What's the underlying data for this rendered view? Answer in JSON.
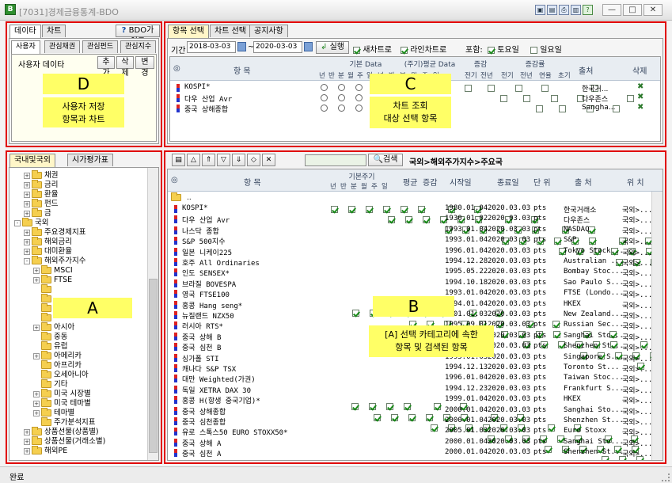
{
  "window": {
    "title": "[7031]경제금융통계-BDO",
    "app_icon": "B"
  },
  "left_top": {
    "tabs": [
      "데이타",
      "차트"
    ],
    "guide_label": "BDO가이드",
    "subtabs": [
      "사용자",
      "관심채권",
      "관심펀드",
      "관심지수"
    ],
    "user_data_label": "사용자 데이타",
    "buttons": [
      "추가",
      "삭제",
      "변경"
    ]
  },
  "callout_d": {
    "letter": "D",
    "line1": "사용자 저장",
    "line2": "항목과 차트"
  },
  "left_bottom": {
    "tabs": [
      "국내및국외",
      "시가평가표"
    ]
  },
  "tree": [
    {
      "label": "채권",
      "indent": 2,
      "exp": "+"
    },
    {
      "label": "금리",
      "indent": 2,
      "exp": "+"
    },
    {
      "label": "환율",
      "indent": 2,
      "exp": "+"
    },
    {
      "label": "펀드",
      "indent": 2,
      "exp": "+"
    },
    {
      "label": "금",
      "indent": 2,
      "exp": "+"
    },
    {
      "label": "국외",
      "indent": 1,
      "exp": "-"
    },
    {
      "label": "주요경제지표",
      "indent": 2,
      "exp": "+"
    },
    {
      "label": "해외금리",
      "indent": 2,
      "exp": "+"
    },
    {
      "label": "대미환율",
      "indent": 2,
      "exp": "+"
    },
    {
      "label": "해외주가지수",
      "indent": 2,
      "exp": "-"
    },
    {
      "label": "MSCI",
      "indent": 3,
      "exp": "+"
    },
    {
      "label": "FTSE",
      "indent": 3,
      "exp": "+"
    },
    {
      "label": "",
      "indent": 3,
      "exp": ""
    },
    {
      "label": "",
      "indent": 3,
      "exp": ""
    },
    {
      "label": "",
      "indent": 3,
      "exp": ""
    },
    {
      "label": "",
      "indent": 3,
      "exp": ""
    },
    {
      "label": "아시아",
      "indent": 3,
      "exp": "+"
    },
    {
      "label": "중동",
      "indent": 3,
      "exp": ""
    },
    {
      "label": "유럽",
      "indent": 3,
      "exp": ""
    },
    {
      "label": "아메리카",
      "indent": 3,
      "exp": "+"
    },
    {
      "label": "아프리카",
      "indent": 3,
      "exp": ""
    },
    {
      "label": "오세아니아",
      "indent": 3,
      "exp": ""
    },
    {
      "label": "기타",
      "indent": 3,
      "exp": ""
    },
    {
      "label": "미국 시장별",
      "indent": 3,
      "exp": "+"
    },
    {
      "label": "미국 테마별",
      "indent": 3,
      "exp": "+"
    },
    {
      "label": "테마별",
      "indent": 3,
      "exp": "+"
    },
    {
      "label": "주가분석지표",
      "indent": 3,
      "exp": ""
    },
    {
      "label": "상품선물(상품별)",
      "indent": 2,
      "exp": "+"
    },
    {
      "label": "상품선물(거래소별)",
      "indent": 2,
      "exp": "+"
    },
    {
      "label": "해외PE",
      "indent": 2,
      "exp": "+"
    }
  ],
  "callout_a": {
    "letter": "A"
  },
  "right_top": {
    "tabs": [
      "항목 선택",
      "차트 선택",
      "공지사항"
    ],
    "period_label": "기간",
    "date_from": "2018-03-03",
    "date_sep": "~",
    "date_to": "2020-03-03",
    "run_label": "실행",
    "new_chart_label": "새차트로",
    "line_chart_label": "라인차트로",
    "include_label": "포함:",
    "sat_label": "토요일",
    "sun_label": "일요일"
  },
  "top_table": {
    "headers": {
      "item": "항   목",
      "basic": "기본 Data",
      "avg": "(주기)평균 Data",
      "change": "증감",
      "ratio": "증감률",
      "source": "출처",
      "delete": "삭제"
    },
    "sub_headers": [
      "년",
      "반",
      "분",
      "월",
      "주",
      "일",
      "년",
      "반",
      "분",
      "월",
      "주",
      "일",
      "전기",
      "전년",
      "전기",
      "전년",
      "연율",
      "초기"
    ],
    "rows": [
      {
        "name": "KOSPI*",
        "source": "한국거..."
      },
      {
        "name": "다우 산업 Avr",
        "source": "다우존스"
      },
      {
        "name": "중국 상해종합",
        "source": "Sangha..."
      }
    ]
  },
  "callout_c": {
    "letter": "C",
    "line1": "차트 조회",
    "line2": "대상 선택 항목"
  },
  "right_bottom": {
    "search_label": "검색",
    "path": "국외>해외주가지수>주요국",
    "headers": {
      "item": "항   목",
      "period": "기본주기",
      "sub": [
        "년",
        "반",
        "분",
        "월",
        "주",
        "일"
      ],
      "avg": "평균",
      "change": "증감",
      "start": "시작일",
      "end": "종료일",
      "unit": "단 위",
      "source": "출   처",
      "location": "위   치"
    },
    "parent": ".."
  },
  "grid_rows": [
    {
      "name": "KOSPI*",
      "start": "1980.01.04",
      "end": "2020.03.03",
      "unit": "pts",
      "source": "한국거래소",
      "loc": "국외>..."
    },
    {
      "name": "다우 산업 Avr",
      "start": "1930.01.02",
      "end": "2020.03.03",
      "unit": "pts",
      "source": "다우존스",
      "loc": "국외>..."
    },
    {
      "name": "나스닥 종합",
      "start": "1993.01.04",
      "end": "2020.03.03",
      "unit": "pts",
      "source": "NASDAQ",
      "loc": "국외>..."
    },
    {
      "name": "S&P 500지수",
      "start": "1993.01.04",
      "end": "2020.03.03",
      "unit": "pts",
      "source": "S&P",
      "loc": "국외>..."
    },
    {
      "name": "일본 니케이225",
      "start": "1996.01.04",
      "end": "2020.03.03",
      "unit": "pts",
      "source": "Tokyo Stock...",
      "loc": "국외>..."
    },
    {
      "name": "호주 All Ordinaries",
      "start": "1994.12.28",
      "end": "2020.03.03",
      "unit": "pts",
      "source": "Australian ...",
      "loc": "국외>..."
    },
    {
      "name": "인도 SENSEX*",
      "start": "1995.05.22",
      "end": "2020.03.03",
      "unit": "pts",
      "source": "Bombay Stoc...",
      "loc": "국외>..."
    },
    {
      "name": "브라질 BOVESPA",
      "start": "1994.10.18",
      "end": "2020.03.03",
      "unit": "pts",
      "source": "Sao Paulo S...",
      "loc": "국외>..."
    },
    {
      "name": "영국 FTSE100",
      "start": "1993.01.04",
      "end": "2020.03.03",
      "unit": "pts",
      "source": "FTSE (Londo...",
      "loc": "국외>..."
    },
    {
      "name": "홍콩 Hang seng*",
      "start": "1994.01.04",
      "end": "2020.03.03",
      "unit": "pts",
      "source": "HKEX",
      "loc": "국외>..."
    },
    {
      "name": "뉴질랜드 NZX50",
      "start": "2001.01.03",
      "end": "2020.03.03",
      "unit": "pts",
      "source": "New Zealand...",
      "loc": "국외>..."
    },
    {
      "name": "러시아 RTS*",
      "start": "1995.09.01",
      "end": "2020.03.03",
      "unit": "pts",
      "source": "Russian Sec...",
      "loc": "국외>..."
    },
    {
      "name": "중국 상해 B",
      "start": "1992.02.21",
      "end": "2020.03.03",
      "unit": "pts",
      "source": "Sanghai Sto...",
      "loc": "국외>..."
    },
    {
      "name": "중국 심천 B",
      "start": "1992.10.04",
      "end": "2020.03.03",
      "unit": "pts",
      "source": "Shenzhen St...",
      "loc": "국외>..."
    },
    {
      "name": "싱가폴 STI",
      "start": "1995.01.03",
      "end": "2020.03.03",
      "unit": "pts",
      "source": "Singapore S...",
      "loc": "국외>..."
    },
    {
      "name": "캐나다 S&P TSX",
      "start": "1994.12.13",
      "end": "2020.03.03",
      "unit": "pts",
      "source": "Toronto St...",
      "loc": "국외>..."
    },
    {
      "name": "대만 Weighted(가권)",
      "start": "1996.01.04",
      "end": "2020.03.03",
      "unit": "pts",
      "source": "Taiwan Stoc...",
      "loc": "국외>..."
    },
    {
      "name": "독일 XETRA DAX 30",
      "start": "1994.12.23",
      "end": "2020.03.03",
      "unit": "pts",
      "source": "Frankfurt S...",
      "loc": "국외>..."
    },
    {
      "name": "홍콩 H(항생 중국기업)*",
      "start": "1999.01.04",
      "end": "2020.03.03",
      "unit": "pts",
      "source": "HKEX",
      "loc": "국외>..."
    },
    {
      "name": "중국 상해종합",
      "start": "2000.01.04",
      "end": "2020.03.03",
      "unit": "pts",
      "source": "Sanghai Sto...",
      "loc": "국외>..."
    },
    {
      "name": "중국 심천종합",
      "start": "2000.01.04",
      "end": "2020.03.03",
      "unit": "pts",
      "source": "Shenzhen St...",
      "loc": "국외>..."
    },
    {
      "name": "유로 스톡스50 EURO STOXX50*",
      "start": "2005.01.03",
      "end": "2020.03.03",
      "unit": "pts",
      "source": "Euro Stoxx",
      "loc": "국외>..."
    },
    {
      "name": "중국 상해 A",
      "start": "2000.01.04",
      "end": "2020.03.03",
      "unit": "pts",
      "source": "Sanghai Sto...",
      "loc": "국외>..."
    },
    {
      "name": "중국 심천 A",
      "start": "2000.01.04",
      "end": "2020.03.03",
      "unit": "pts",
      "source": "Shenzhen St...",
      "loc": "국외>..."
    }
  ],
  "callout_b": {
    "letter": "B",
    "line1": "[A] 선택 카테고리에 속한",
    "line2": "항목 및 검색된 항목"
  },
  "status": {
    "text": "완료"
  },
  "colors": {
    "red_frame": "#e00000",
    "callout": "#ffff66",
    "header_bg": "#e8edf2"
  }
}
